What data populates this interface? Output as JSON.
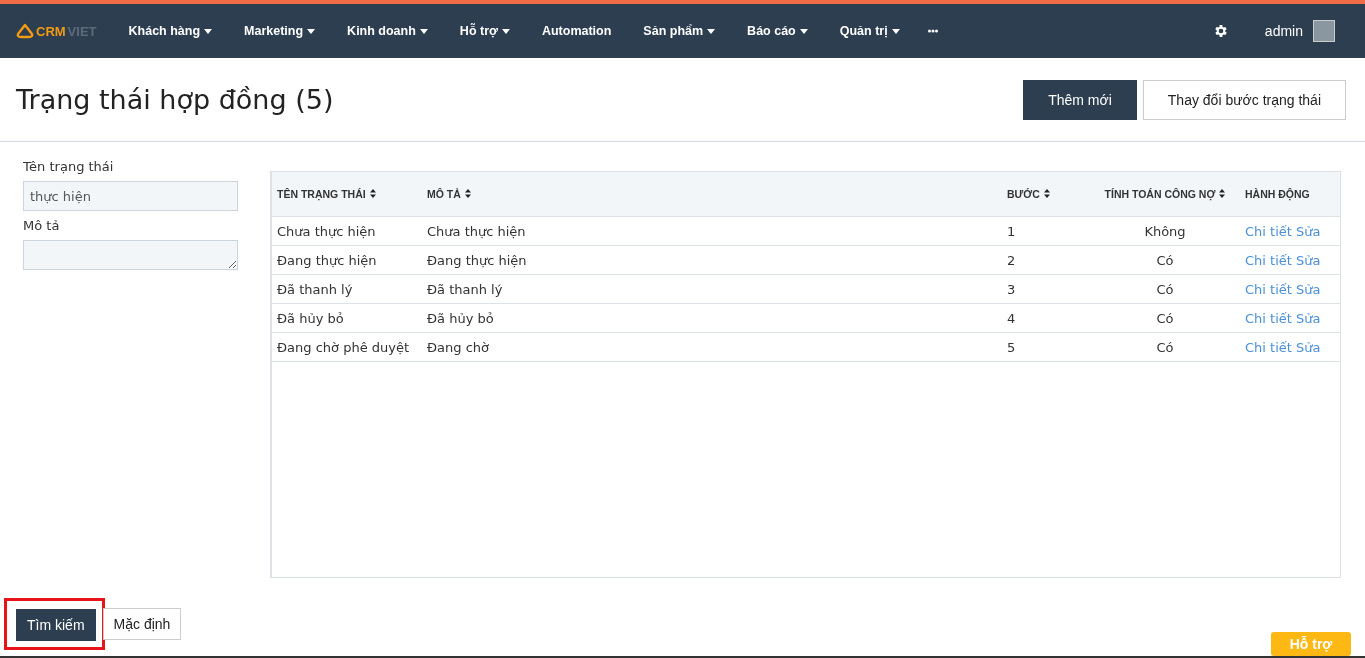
{
  "navbar": {
    "logo": [
      "CRM",
      "VIET"
    ],
    "menu": [
      {
        "label": "Khách hàng",
        "kind": "dropdown"
      },
      {
        "label": "Marketing",
        "kind": "dropdown"
      },
      {
        "label": "Kinh doanh",
        "kind": "dropdown"
      },
      {
        "label": "Hỗ trợ",
        "kind": "dropdown"
      },
      {
        "label": "Automation",
        "kind": "link"
      },
      {
        "label": "Sản phẩm",
        "kind": "dropdown"
      },
      {
        "label": "Báo cáo",
        "kind": "dropdown"
      },
      {
        "label": "Quản trị",
        "kind": "dropdown"
      },
      {
        "kind": "more"
      }
    ],
    "user": "admin"
  },
  "page_title": "Trạng thái hợp đồng (5)",
  "header_buttons": [
    {
      "label": "Thêm mới",
      "kind": "primary"
    },
    {
      "label": "Thay đổi bước trạng thái",
      "kind": "default"
    }
  ],
  "filters": [
    {
      "label": "Tên trạng thái",
      "kind": "input",
      "value": "thực hiện"
    },
    {
      "label": "Mô tả",
      "kind": "textarea"
    }
  ],
  "table": {
    "columns": [
      {
        "label": "TÊN TRẠNG THÁI",
        "sortable": true
      },
      {
        "label": "MÔ TẢ",
        "sortable": true
      },
      {
        "label": "BƯỚC",
        "sortable": true
      },
      {
        "label": "TÍNH TOÁN CÔNG NỢ",
        "sortable": true
      },
      {
        "label": "HÀNH ĐỘNG",
        "sortable": false
      }
    ],
    "rows": [
      {
        "name": "Chưa thực hiện",
        "description": "Chưa thực hiện",
        "step": "1",
        "debt": "Không",
        "actions": [
          "Chi tiết",
          "Sửa"
        ]
      },
      {
        "name": "Đang thực hiện",
        "description": "Đang thực hiện",
        "step": "2",
        "debt": "Có",
        "actions": [
          "Chi tiết",
          "Sửa"
        ]
      },
      {
        "name": "Đã thanh lý",
        "description": "Đã thanh lý",
        "step": "3",
        "debt": "Có",
        "actions": [
          "Chi tiết",
          "Sửa"
        ]
      },
      {
        "name": "Đã hủy bỏ",
        "description": "Đã hủy bỏ",
        "step": "4",
        "debt": "Có",
        "actions": [
          "Chi tiết",
          "Sửa"
        ]
      },
      {
        "name": "Đang chờ phê duyệt",
        "description": "Đang chờ",
        "step": "5",
        "debt": "Có",
        "actions": [
          "Chi tiết",
          "Sửa"
        ]
      }
    ]
  },
  "footer_buttons": [
    {
      "label": "Tìm kiếm",
      "kind": "primary",
      "highlighted": true
    },
    {
      "label": "Mặc định",
      "kind": "default",
      "highlighted": false
    }
  ],
  "help_button": "Hỗ trợ"
}
